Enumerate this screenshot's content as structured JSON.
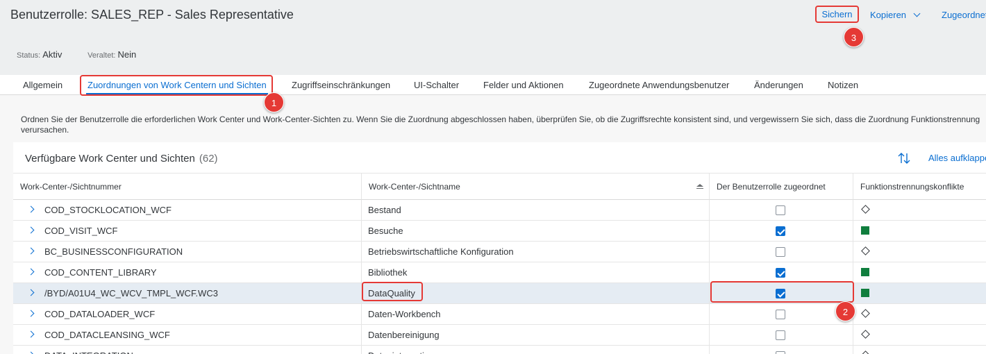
{
  "header": {
    "title": "Benutzerrolle: SALES_REP - Sales Representative",
    "status_label": "Status:",
    "status_value": "Aktiv",
    "obsolete_label": "Veraltet:",
    "obsolete_value": "Nein",
    "save_label": "Sichern",
    "copy_label": "Kopieren",
    "assigned_label": "Zugeordnet"
  },
  "tabs": [
    {
      "label": "Allgemein"
    },
    {
      "label": "Zuordnungen von Work Centern und Sichten"
    },
    {
      "label": "Zugriffseinschränkungen"
    },
    {
      "label": "UI-Schalter"
    },
    {
      "label": "Felder und Aktionen"
    },
    {
      "label": "Zugeordnete Anwendungsbenutzer"
    },
    {
      "label": "Änderungen"
    },
    {
      "label": "Notizen"
    }
  ],
  "active_tab": "Zuordnungen von Work Centern und Sichten",
  "description": "Ordnen Sie der Benutzerrolle die erforderlichen Work Center und Work-Center-Sichten zu. Wenn Sie die Zuordnung abgeschlossen haben, überprüfen Sie, ob die Zugriffsrechte konsistent sind, und vergewissern Sie sich, dass die Zuordnung Funktionstrennung verursachen.",
  "table": {
    "title": "Verfügbare Work Center und Sichten",
    "count": "(62)",
    "expand_all": "Alles aufklappen",
    "columns": [
      "Work-Center-/Sichtnummer",
      "Work-Center-/Sichtname",
      "Der Benutzerrolle zugeordnet",
      "Funktionstrennungskonflikte"
    ],
    "rows": [
      {
        "number": "COD_STOCKLOCATION_WCF",
        "name": "Bestand",
        "assigned": false,
        "conflict": "diamond"
      },
      {
        "number": "COD_VISIT_WCF",
        "name": "Besuche",
        "assigned": true,
        "conflict": "green"
      },
      {
        "number": "BC_BUSINESSCONFIGURATION",
        "name": "Betriebswirtschaftliche Konfiguration",
        "assigned": false,
        "conflict": "diamond"
      },
      {
        "number": "COD_CONTENT_LIBRARY",
        "name": "Bibliothek",
        "assigned": true,
        "conflict": "green"
      },
      {
        "number": "/BYD/A01U4_WC_WCV_TMPL_WCF.WC3",
        "name": "DataQuality",
        "assigned": true,
        "conflict": "green"
      },
      {
        "number": "COD_DATALOADER_WCF",
        "name": "Daten-Workbench",
        "assigned": false,
        "conflict": "diamond"
      },
      {
        "number": "COD_DATACLEANSING_WCF",
        "name": "Datenbereinigung",
        "assigned": false,
        "conflict": "diamond"
      },
      {
        "number": "DATA_INTEGRATION",
        "name": "Datenintegration",
        "assigned": false,
        "conflict": "diamond"
      }
    ]
  },
  "badges": [
    "1",
    "2",
    "3"
  ],
  "colors": {
    "accent": "#0a6ed1",
    "annotation": "#e53935",
    "ok": "#107e3e"
  }
}
